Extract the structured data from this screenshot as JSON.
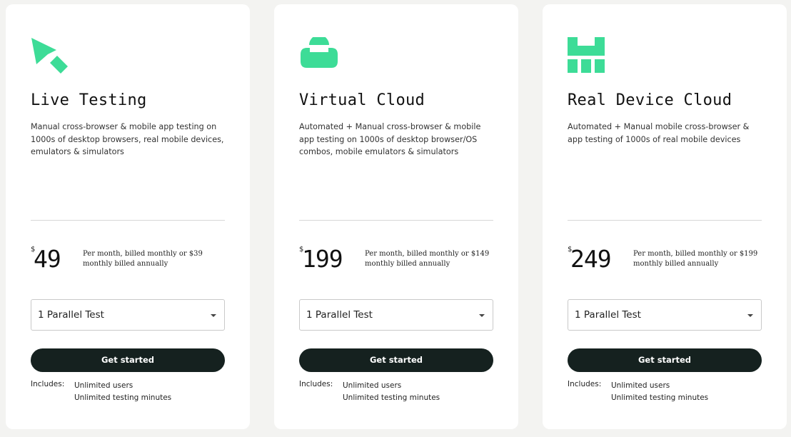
{
  "colors": {
    "accent": "#3ddc97",
    "button_bg": "#15211f",
    "card_bg": "#ffffff",
    "page_bg": "#f3f3f1"
  },
  "plans": [
    {
      "icon": "cursor-arrow-icon",
      "title": "Live Testing",
      "description": "Manual cross-browser & mobile app testing on 1000s of desktop browsers, real mobile devices, emulators & simulators",
      "currency": "$",
      "price": "49",
      "price_note": "Per month, billed monthly or $39 monthly billed annually",
      "select_value": "1 Parallel Test",
      "cta_label": "Get started",
      "includes_label": "Includes:",
      "includes": [
        "Unlimited users",
        "Unlimited testing minutes"
      ]
    },
    {
      "icon": "cloud-icon",
      "title": "Virtual Cloud",
      "description": "Automated + Manual cross-browser & mobile app testing on 1000s of desktop browser/OS combos, mobile emulators & simulators",
      "currency": "$",
      "price": "199",
      "price_note": "Per month, billed monthly or $149 monthly billed annually",
      "select_value": "1 Parallel Test",
      "cta_label": "Get started",
      "includes_label": "Includes:",
      "includes": [
        "Unlimited users",
        "Unlimited testing minutes"
      ]
    },
    {
      "icon": "device-grid-icon",
      "title": "Real Device Cloud",
      "description": "Automated + Manual mobile cross-browser & app testing of 1000s of real mobile devices",
      "currency": "$",
      "price": "249",
      "price_note": "Per month, billed monthly or $199 monthly billed annually",
      "select_value": "1 Parallel Test",
      "cta_label": "Get started",
      "includes_label": "Includes:",
      "includes": [
        "Unlimited users",
        "Unlimited testing minutes"
      ]
    }
  ]
}
